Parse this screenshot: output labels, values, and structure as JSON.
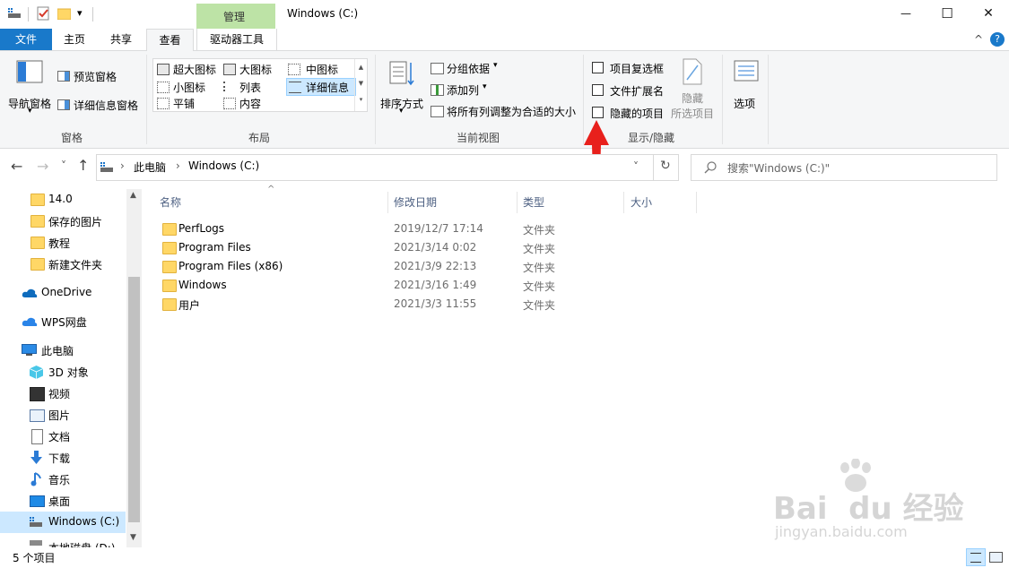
{
  "window": {
    "title": "Windows (C:)",
    "minimize": "—",
    "maximize": "☐",
    "close": "✕",
    "quick_access_dropdown": "▾"
  },
  "ribbon_tabs": {
    "file": "文件",
    "home": "主页",
    "share": "共享",
    "view": "查看",
    "manage_context": "管理",
    "drive_tools": "驱动器工具",
    "collapse": "^",
    "help": "?"
  },
  "ribbon": {
    "panes": {
      "nav_pane": "导航窗格",
      "nav_pane_arrow": "▾",
      "preview_pane": "预览窗格",
      "details_pane": "详细信息窗格",
      "group_label": "窗格"
    },
    "layout": {
      "extra_large": "超大图标",
      "large": "大图标",
      "medium": "中图标",
      "small": "小图标",
      "list": "列表",
      "details": "详细信息",
      "tiles": "平铺",
      "content": "内容",
      "group_label": "布局"
    },
    "current_view": {
      "sort_by": "排序方式",
      "group_by": "分组依据",
      "add_columns": "添加列",
      "size_all_columns": "将所有列调整为合适的大小",
      "group_label": "当前视图"
    },
    "show_hide": {
      "item_checkboxes": "项目复选框",
      "file_extensions": "文件扩展名",
      "hidden_items": "隐藏的项目",
      "hide_selected_1": "隐藏",
      "hide_selected_2": "所选项目",
      "group_label": "显示/隐藏"
    },
    "options": "选项"
  },
  "address_bar": {
    "back": "←",
    "forward": "→",
    "recent": "˅",
    "up": "↑",
    "crumbs": [
      "此电脑",
      "Windows (C:)"
    ],
    "separator": "›",
    "dropdown": "˅",
    "refresh": "↻",
    "search_placeholder": "搜索\"Windows (C:)\""
  },
  "nav_pane": {
    "items": [
      {
        "label": "14.0",
        "icon": "folder-icon"
      },
      {
        "label": "保存的图片",
        "icon": "folder-icon"
      },
      {
        "label": "教程",
        "icon": "folder-icon"
      },
      {
        "label": "新建文件夹",
        "icon": "folder-icon"
      },
      {
        "label": "OneDrive",
        "icon": "cloud-icon"
      },
      {
        "label": "WPS网盘",
        "icon": "wps-cloud-icon"
      },
      {
        "label": "此电脑",
        "icon": "computer-icon"
      },
      {
        "label": "3D 对象",
        "icon": "cube-icon"
      },
      {
        "label": "视频",
        "icon": "video-icon"
      },
      {
        "label": "图片",
        "icon": "picture-icon"
      },
      {
        "label": "文档",
        "icon": "document-icon"
      },
      {
        "label": "下载",
        "icon": "download-icon"
      },
      {
        "label": "音乐",
        "icon": "music-icon"
      },
      {
        "label": "桌面",
        "icon": "desktop-icon"
      },
      {
        "label": "Windows (C:)",
        "icon": "drive-icon"
      },
      {
        "label": "本地磁盘 (D:)",
        "icon": "drive-icon"
      }
    ]
  },
  "file_list": {
    "columns": {
      "name": "名称",
      "modified": "修改日期",
      "type": "类型",
      "size": "大小"
    },
    "sort_arrow": "^",
    "rows": [
      {
        "name": "PerfLogs",
        "modified": "2019/12/7 17:14",
        "type": "文件夹"
      },
      {
        "name": "Program Files",
        "modified": "2021/3/14 0:02",
        "type": "文件夹"
      },
      {
        "name": "Program Files (x86)",
        "modified": "2021/3/9 22:13",
        "type": "文件夹"
      },
      {
        "name": "Windows",
        "modified": "2021/3/16 1:49",
        "type": "文件夹"
      },
      {
        "name": "用户",
        "modified": "2021/3/3 11:55",
        "type": "文件夹"
      }
    ]
  },
  "status_bar": {
    "count": "5 个项目"
  },
  "watermark": {
    "brand": "Bai  du 经验",
    "url": "jingyan.baidu.com"
  },
  "colors": {
    "accent": "#1979ca",
    "manage_tab": "#bde3a6",
    "annotation_arrow": "#e8201c"
  }
}
